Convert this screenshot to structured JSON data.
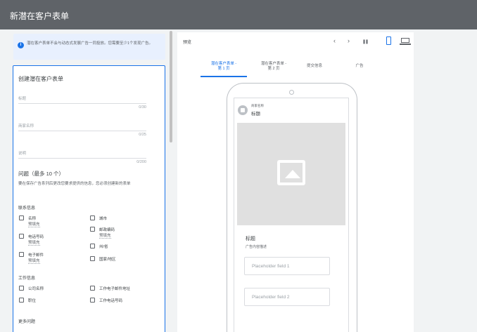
{
  "header": {
    "title": "新潜在客户表单"
  },
  "notice": {
    "text": "潜在客户表单不会与动态式发展广告一同投放。您需要至少1个发现广告。"
  },
  "form": {
    "title": "创建潜在客户表单",
    "headline": {
      "label": "标题",
      "count": "0/30"
    },
    "business_name": {
      "label": "商家名称",
      "count": "0/25"
    },
    "description": {
      "label": "说明",
      "count": "0/200"
    },
    "questions_title": "问题（最多 10 个）",
    "questions_desc": "要在保存广告系列后更改您要求提供的信息，您必须创建新的表单",
    "contact_section": "联系信息",
    "contact_left": [
      {
        "label": "名称",
        "sub": "预填充"
      },
      {
        "label": "电话号码",
        "sub": "预填充"
      },
      {
        "label": "电子邮件",
        "sub": "预填充"
      }
    ],
    "contact_right": [
      {
        "label": "城市",
        "sub": ""
      },
      {
        "label": "邮政编码",
        "sub": "预填充"
      },
      {
        "label": "州/省",
        "sub": ""
      },
      {
        "label": "国家/地区",
        "sub": ""
      }
    ],
    "work_section": "工作信息",
    "work_left": [
      {
        "label": "公司名称"
      },
      {
        "label": "职位"
      }
    ],
    "work_right": [
      {
        "label": "工作电子邮件地址"
      },
      {
        "label": "工作电话号码"
      }
    ],
    "more_section": "更多问题"
  },
  "preview": {
    "label": "预览",
    "controls": {
      "prev": "‹",
      "next": "›",
      "pause": "❚❚"
    },
    "tabs": [
      {
        "line1": "潜在客户表单 -",
        "line2": "第 1 页"
      },
      {
        "line1": "潜在客户表单 -",
        "line2": "第 2 页"
      },
      {
        "line1": "提交信息",
        "line2": ""
      },
      {
        "line1": "广告",
        "line2": ""
      }
    ],
    "active_tab": 0,
    "phone": {
      "business_name": "商家名称",
      "headline": "标题",
      "card_headline": "标题",
      "card_desc": "广告内容描述",
      "fields": [
        "Placeholder field 1",
        "Placeholder field 2"
      ]
    }
  },
  "colors": {
    "accent": "#1a73e8",
    "header_bg": "#5f6368",
    "panel_bg": "#f1f3f4"
  },
  "icons": [
    "info-icon",
    "chevron-left-icon",
    "chevron-right-icon",
    "pause-icon",
    "phone-icon",
    "desktop-icon",
    "image-placeholder-icon"
  ]
}
